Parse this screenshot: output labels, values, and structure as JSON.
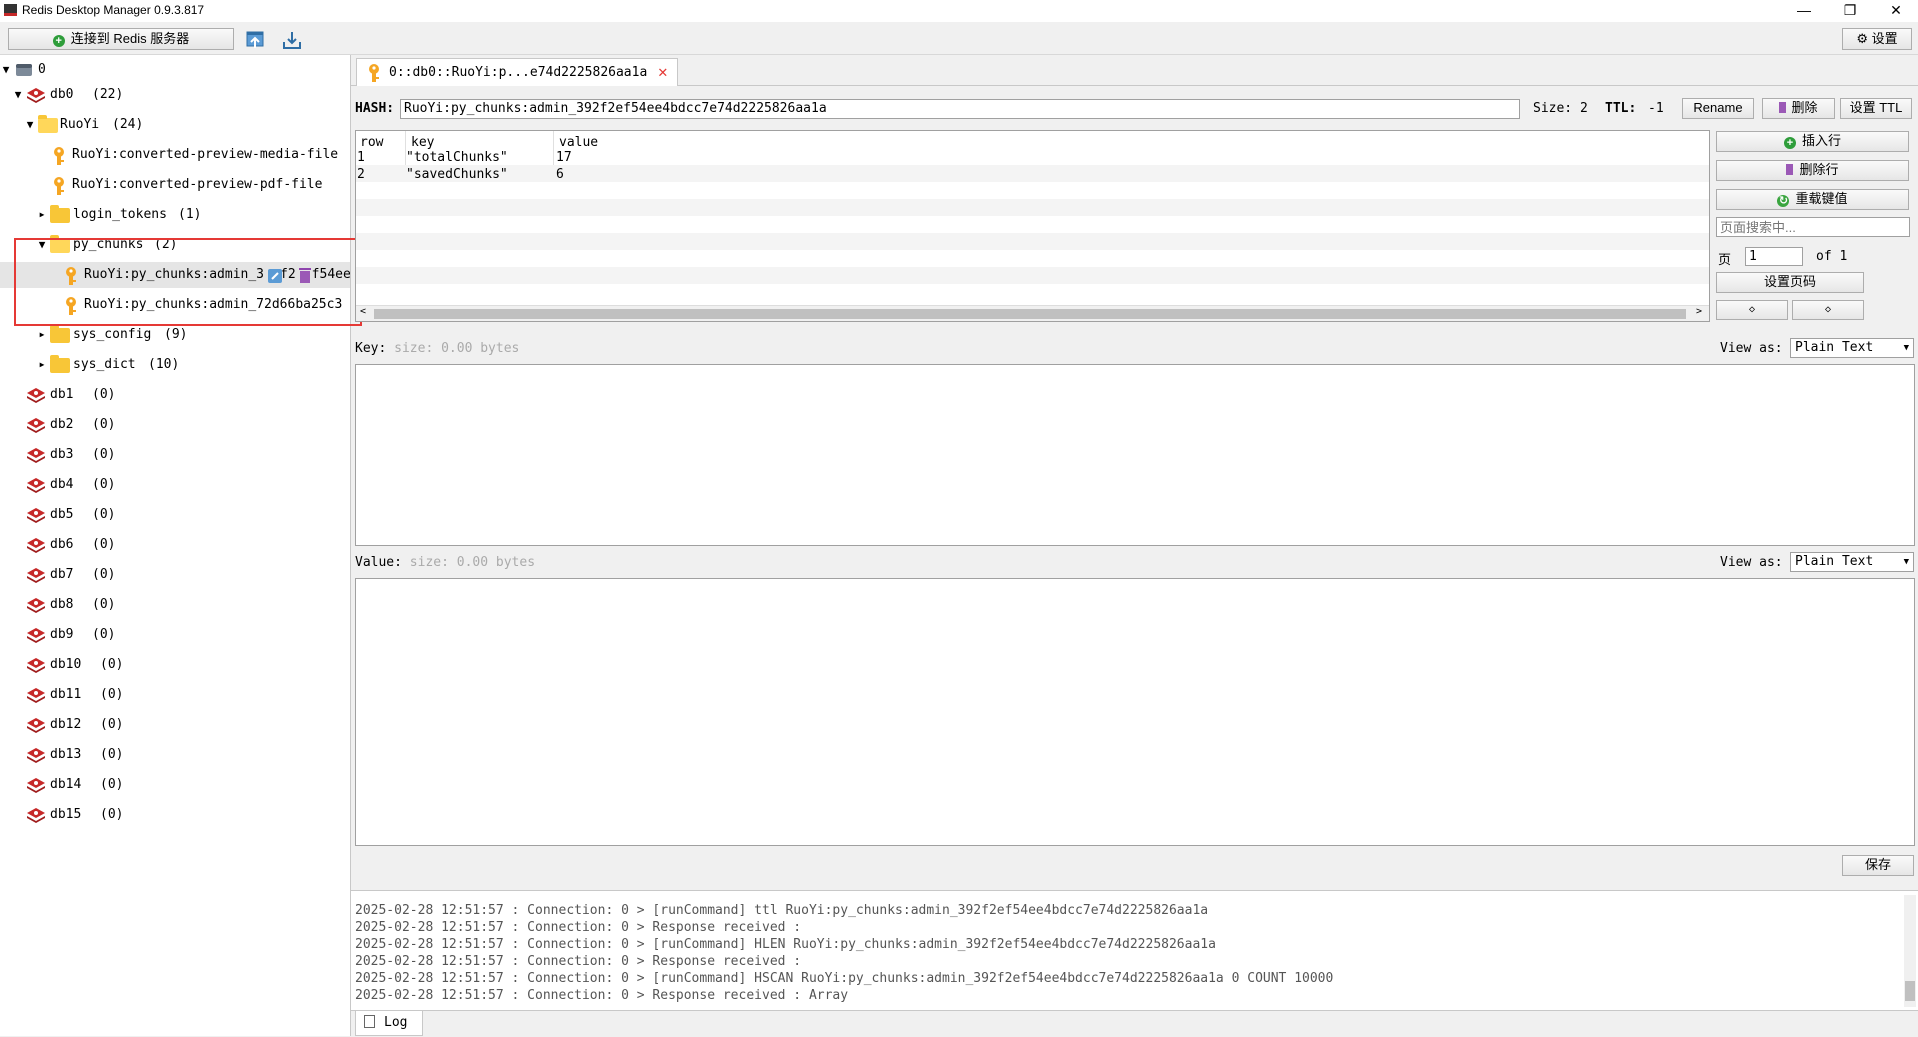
{
  "window": {
    "title": "Redis Desktop Manager 0.9.3.817",
    "min_icon": "minimize-icon",
    "max_icon": "restore-icon",
    "close_icon": "close-icon"
  },
  "toolbar": {
    "connect_label": "连接到 Redis 服务器",
    "settings_label": "设置"
  },
  "tree": {
    "root": "0",
    "db0": "db0",
    "db0_count": "(22)",
    "ruoyi": "RuoYi",
    "ruoyi_count": "(24)",
    "key1": "RuoYi:converted-preview-media-file",
    "key2": "RuoYi:converted-preview-pdf-file",
    "login_tokens": "login_tokens",
    "login_tokens_count": "(1)",
    "py_chunks": "py_chunks",
    "py_chunks_count": "(2)",
    "chunk1_a": "RuoYi:py_chunks:admin_3",
    "chunk1_b": "f2",
    "chunk1_c": "f54ee",
    "chunk2": "RuoYi:py_chunks:admin_72d66ba25c3",
    "sys_config": "sys_config",
    "sys_config_count": "(9)",
    "sys_dict": "sys_dict",
    "sys_dict_count": "(10)",
    "dbs": [
      {
        "name": "db1",
        "count": "(0)"
      },
      {
        "name": "db2",
        "count": "(0)"
      },
      {
        "name": "db3",
        "count": "(0)"
      },
      {
        "name": "db4",
        "count": "(0)"
      },
      {
        "name": "db5",
        "count": "(0)"
      },
      {
        "name": "db6",
        "count": "(0)"
      },
      {
        "name": "db7",
        "count": "(0)"
      },
      {
        "name": "db8",
        "count": "(0)"
      },
      {
        "name": "db9",
        "count": "(0)"
      },
      {
        "name": "db10",
        "count": "(0)"
      },
      {
        "name": "db11",
        "count": "(0)"
      },
      {
        "name": "db12",
        "count": "(0)"
      },
      {
        "name": "db13",
        "count": "(0)"
      },
      {
        "name": "db14",
        "count": "(0)"
      },
      {
        "name": "db15",
        "count": "(0)"
      }
    ]
  },
  "tab": {
    "label": "0::db0::RuoYi:p...e74d2225826aa1a"
  },
  "hash": {
    "type_label": "HASH:",
    "key_value": "RuoYi:py_chunks:admin_392f2ef54ee4bdcc7e74d2225826aa1a",
    "size_label": "Size: 2",
    "ttl_label": "TTL:",
    "ttl_value": "-1",
    "rename_label": "Rename",
    "delete_label": "删除",
    "set_ttl_label": "设置 TTL"
  },
  "table": {
    "headers": [
      "row",
      "key",
      "value"
    ],
    "rows": [
      {
        "row": "1",
        "key": "\"totalChunks\"",
        "value": "17"
      },
      {
        "row": "2",
        "key": "\"savedChunks\"",
        "value": "6"
      }
    ]
  },
  "side": {
    "insert_row": "插入行",
    "delete_row": "删除行",
    "reload": "重载键值",
    "search_placeholder": "页面搜索中...",
    "page_label": "页",
    "page_value": "1",
    "of_label": "of 1",
    "set_page": "设置页码",
    "prev": "◇",
    "next": "◇"
  },
  "key_panel": {
    "label": "Key:",
    "size": "size: 0.00 bytes",
    "view_as": "View as:",
    "format": "Plain Text"
  },
  "value_panel": {
    "label": "Value:",
    "size": "size: 0.00 bytes",
    "view_as": "View as:",
    "format": "Plain Text",
    "save": "保存"
  },
  "log": {
    "lines": [
      "2025-02-28 12:51:57 : Connection: 0 > [runCommand] ttl RuoYi:py_chunks:admin_392f2ef54ee4bdcc7e74d2225826aa1a",
      "2025-02-28 12:51:57 : Connection: 0 > Response received :",
      "2025-02-28 12:51:57 : Connection: 0 > [runCommand] HLEN RuoYi:py_chunks:admin_392f2ef54ee4bdcc7e74d2225826aa1a",
      "2025-02-28 12:51:57 : Connection: 0 > Response received :",
      "2025-02-28 12:51:57 : Connection: 0 > [runCommand] HSCAN RuoYi:py_chunks:admin_392f2ef54ee4bdcc7e74d2225826aa1a 0 COUNT 10000",
      "2025-02-28 12:51:57 : Connection: 0 > Response received : Array"
    ],
    "tab_label": "Log"
  }
}
